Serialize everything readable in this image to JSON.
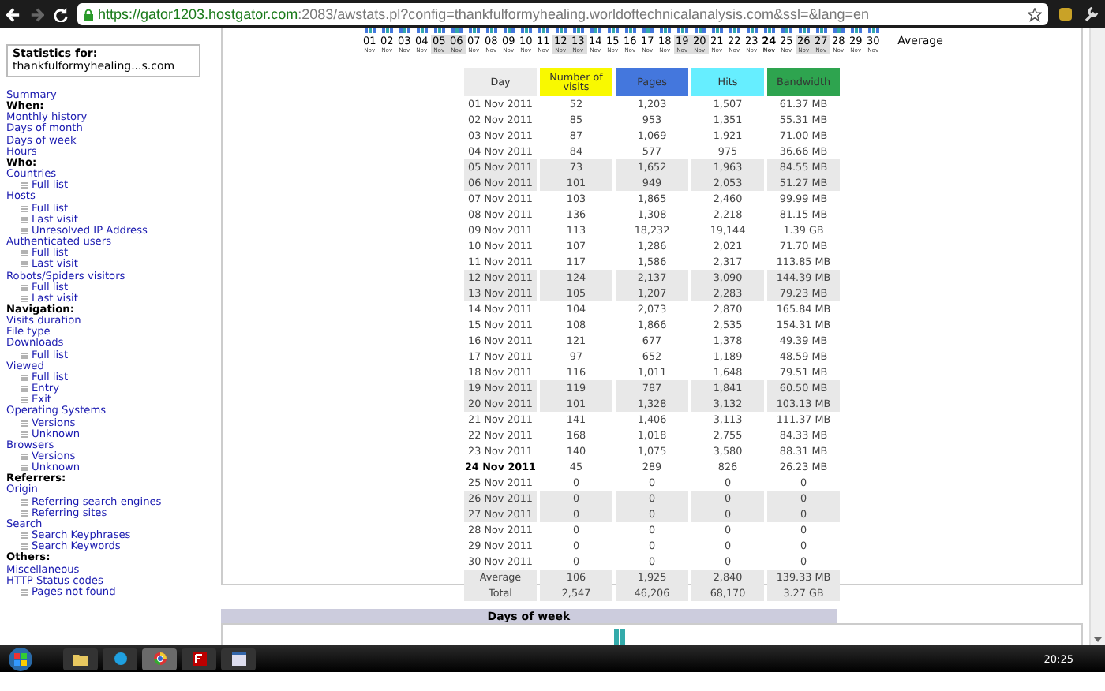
{
  "browser": {
    "url_host": "https://gator1203.hostgator.com",
    "url_rest": ":2083/awstats.pl?config=thankfulformyhealing.worldoftechnicalanalysis.com&ssl=&lang=en"
  },
  "sidebar": {
    "title": "Statistics for:",
    "site": "thankfulformyhealing...s.com",
    "nav": [
      {
        "kind": "link",
        "label": "Summary"
      },
      {
        "kind": "heading",
        "label": "When:"
      },
      {
        "kind": "link",
        "label": "Monthly history"
      },
      {
        "kind": "link",
        "label": "Days of month"
      },
      {
        "kind": "link",
        "label": "Days of week"
      },
      {
        "kind": "link",
        "label": "Hours"
      },
      {
        "kind": "heading",
        "label": "Who:"
      },
      {
        "kind": "link",
        "label": "Countries",
        "children": [
          {
            "label": "Full list"
          }
        ]
      },
      {
        "kind": "link",
        "label": "Hosts",
        "children": [
          {
            "label": "Full list"
          },
          {
            "label": "Last visit"
          },
          {
            "label": "Unresolved IP Address"
          }
        ]
      },
      {
        "kind": "link",
        "label": "Authenticated users",
        "children": [
          {
            "label": "Full list"
          },
          {
            "label": "Last visit"
          }
        ]
      },
      {
        "kind": "link",
        "label": "Robots/Spiders visitors",
        "children": [
          {
            "label": "Full list"
          },
          {
            "label": "Last visit"
          }
        ]
      },
      {
        "kind": "heading",
        "label": "Navigation:"
      },
      {
        "kind": "link",
        "label": "Visits duration"
      },
      {
        "kind": "link",
        "label": "File type"
      },
      {
        "kind": "link",
        "label": "Downloads",
        "children": [
          {
            "label": "Full list"
          }
        ]
      },
      {
        "kind": "link",
        "label": "Viewed",
        "children": [
          {
            "label": "Full list"
          },
          {
            "label": "Entry"
          },
          {
            "label": "Exit"
          }
        ]
      },
      {
        "kind": "link",
        "label": "Operating Systems",
        "children": [
          {
            "label": "Versions"
          },
          {
            "label": "Unknown"
          }
        ]
      },
      {
        "kind": "link",
        "label": "Browsers",
        "children": [
          {
            "label": "Versions"
          },
          {
            "label": "Unknown"
          }
        ]
      },
      {
        "kind": "heading",
        "label": "Referrers:"
      },
      {
        "kind": "link",
        "label": "Origin",
        "children": [
          {
            "label": "Referring search engines"
          },
          {
            "label": "Referring sites"
          }
        ]
      },
      {
        "kind": "link",
        "label": "Search",
        "children": [
          {
            "label": "Search Keyphrases"
          },
          {
            "label": "Search Keywords"
          }
        ]
      },
      {
        "kind": "heading",
        "label": "Others:"
      },
      {
        "kind": "link",
        "label": "Miscellaneous"
      },
      {
        "kind": "link",
        "label": "HTTP Status codes",
        "children": [
          {
            "label": "Pages not found"
          }
        ]
      }
    ]
  },
  "day_strip": {
    "days": [
      {
        "day": "01",
        "month": "Nov",
        "weekend": false,
        "today": false
      },
      {
        "day": "02",
        "month": "Nov",
        "weekend": false,
        "today": false
      },
      {
        "day": "03",
        "month": "Nov",
        "weekend": false,
        "today": false
      },
      {
        "day": "04",
        "month": "Nov",
        "weekend": false,
        "today": false
      },
      {
        "day": "05",
        "month": "Nov",
        "weekend": true,
        "today": false
      },
      {
        "day": "06",
        "month": "Nov",
        "weekend": true,
        "today": false
      },
      {
        "day": "07",
        "month": "Nov",
        "weekend": false,
        "today": false
      },
      {
        "day": "08",
        "month": "Nov",
        "weekend": false,
        "today": false
      },
      {
        "day": "09",
        "month": "Nov",
        "weekend": false,
        "today": false
      },
      {
        "day": "10",
        "month": "Nov",
        "weekend": false,
        "today": false
      },
      {
        "day": "11",
        "month": "Nov",
        "weekend": false,
        "today": false
      },
      {
        "day": "12",
        "month": "Nov",
        "weekend": true,
        "today": false
      },
      {
        "day": "13",
        "month": "Nov",
        "weekend": true,
        "today": false
      },
      {
        "day": "14",
        "month": "Nov",
        "weekend": false,
        "today": false
      },
      {
        "day": "15",
        "month": "Nov",
        "weekend": false,
        "today": false
      },
      {
        "day": "16",
        "month": "Nov",
        "weekend": false,
        "today": false
      },
      {
        "day": "17",
        "month": "Nov",
        "weekend": false,
        "today": false
      },
      {
        "day": "18",
        "month": "Nov",
        "weekend": false,
        "today": false
      },
      {
        "day": "19",
        "month": "Nov",
        "weekend": true,
        "today": false
      },
      {
        "day": "20",
        "month": "Nov",
        "weekend": true,
        "today": false
      },
      {
        "day": "21",
        "month": "Nov",
        "weekend": false,
        "today": false
      },
      {
        "day": "22",
        "month": "Nov",
        "weekend": false,
        "today": false
      },
      {
        "day": "23",
        "month": "Nov",
        "weekend": false,
        "today": false
      },
      {
        "day": "24",
        "month": "Nov",
        "weekend": false,
        "today": true
      },
      {
        "day": "25",
        "month": "Nov",
        "weekend": false,
        "today": false
      },
      {
        "day": "26",
        "month": "Nov",
        "weekend": true,
        "today": false
      },
      {
        "day": "27",
        "month": "Nov",
        "weekend": true,
        "today": false
      },
      {
        "day": "28",
        "month": "Nov",
        "weekend": false,
        "today": false
      },
      {
        "day": "29",
        "month": "Nov",
        "weekend": false,
        "today": false
      },
      {
        "day": "30",
        "month": "Nov",
        "weekend": false,
        "today": false
      }
    ],
    "average_label": "Average"
  },
  "table": {
    "columns": [
      {
        "label": "Day",
        "color": "#ececec"
      },
      {
        "label": "Number of visits",
        "color": "#f9f900"
      },
      {
        "label": "Pages",
        "color": "#4477dd"
      },
      {
        "label": "Hits",
        "color": "#66eeff"
      },
      {
        "label": "Bandwidth",
        "color": "#2ea44f"
      }
    ],
    "rows": [
      {
        "cells": [
          "01 Nov 2011",
          "52",
          "1,203",
          "1,507",
          "61.37 MB"
        ],
        "weekend": false,
        "today": false
      },
      {
        "cells": [
          "02 Nov 2011",
          "85",
          "953",
          "1,351",
          "55.31 MB"
        ],
        "weekend": false,
        "today": false
      },
      {
        "cells": [
          "03 Nov 2011",
          "87",
          "1,069",
          "1,921",
          "71.00 MB"
        ],
        "weekend": false,
        "today": false
      },
      {
        "cells": [
          "04 Nov 2011",
          "84",
          "577",
          "975",
          "36.66 MB"
        ],
        "weekend": false,
        "today": false
      },
      {
        "cells": [
          "05 Nov 2011",
          "73",
          "1,652",
          "1,963",
          "84.55 MB"
        ],
        "weekend": true,
        "today": false
      },
      {
        "cells": [
          "06 Nov 2011",
          "101",
          "949",
          "2,053",
          "51.27 MB"
        ],
        "weekend": true,
        "today": false
      },
      {
        "cells": [
          "07 Nov 2011",
          "103",
          "1,865",
          "2,460",
          "99.99 MB"
        ],
        "weekend": false,
        "today": false
      },
      {
        "cells": [
          "08 Nov 2011",
          "136",
          "1,308",
          "2,218",
          "81.15 MB"
        ],
        "weekend": false,
        "today": false
      },
      {
        "cells": [
          "09 Nov 2011",
          "113",
          "18,232",
          "19,144",
          "1.39 GB"
        ],
        "weekend": false,
        "today": false
      },
      {
        "cells": [
          "10 Nov 2011",
          "107",
          "1,286",
          "2,021",
          "71.70 MB"
        ],
        "weekend": false,
        "today": false
      },
      {
        "cells": [
          "11 Nov 2011",
          "117",
          "1,586",
          "2,317",
          "113.85 MB"
        ],
        "weekend": false,
        "today": false
      },
      {
        "cells": [
          "12 Nov 2011",
          "124",
          "2,137",
          "3,090",
          "144.39 MB"
        ],
        "weekend": true,
        "today": false
      },
      {
        "cells": [
          "13 Nov 2011",
          "105",
          "1,207",
          "2,283",
          "79.23 MB"
        ],
        "weekend": true,
        "today": false
      },
      {
        "cells": [
          "14 Nov 2011",
          "104",
          "2,073",
          "2,870",
          "165.84 MB"
        ],
        "weekend": false,
        "today": false
      },
      {
        "cells": [
          "15 Nov 2011",
          "108",
          "1,866",
          "2,535",
          "154.31 MB"
        ],
        "weekend": false,
        "today": false
      },
      {
        "cells": [
          "16 Nov 2011",
          "121",
          "677",
          "1,378",
          "49.39 MB"
        ],
        "weekend": false,
        "today": false
      },
      {
        "cells": [
          "17 Nov 2011",
          "97",
          "652",
          "1,189",
          "48.59 MB"
        ],
        "weekend": false,
        "today": false
      },
      {
        "cells": [
          "18 Nov 2011",
          "116",
          "1,011",
          "1,648",
          "79.51 MB"
        ],
        "weekend": false,
        "today": false
      },
      {
        "cells": [
          "19 Nov 2011",
          "119",
          "787",
          "1,841",
          "60.50 MB"
        ],
        "weekend": true,
        "today": false
      },
      {
        "cells": [
          "20 Nov 2011",
          "101",
          "1,328",
          "3,132",
          "103.13 MB"
        ],
        "weekend": true,
        "today": false
      },
      {
        "cells": [
          "21 Nov 2011",
          "141",
          "1,406",
          "3,113",
          "111.37 MB"
        ],
        "weekend": false,
        "today": false
      },
      {
        "cells": [
          "22 Nov 2011",
          "168",
          "1,018",
          "2,755",
          "84.33 MB"
        ],
        "weekend": false,
        "today": false
      },
      {
        "cells": [
          "23 Nov 2011",
          "140",
          "1,075",
          "3,580",
          "88.31 MB"
        ],
        "weekend": false,
        "today": false
      },
      {
        "cells": [
          "24 Nov 2011",
          "45",
          "289",
          "826",
          "26.23 MB"
        ],
        "weekend": false,
        "today": true
      },
      {
        "cells": [
          "25 Nov 2011",
          "0",
          "0",
          "0",
          "0"
        ],
        "weekend": false,
        "today": false
      },
      {
        "cells": [
          "26 Nov 2011",
          "0",
          "0",
          "0",
          "0"
        ],
        "weekend": true,
        "today": false
      },
      {
        "cells": [
          "27 Nov 2011",
          "0",
          "0",
          "0",
          "0"
        ],
        "weekend": true,
        "today": false
      },
      {
        "cells": [
          "28 Nov 2011",
          "0",
          "0",
          "0",
          "0"
        ],
        "weekend": false,
        "today": false
      },
      {
        "cells": [
          "29 Nov 2011",
          "0",
          "0",
          "0",
          "0"
        ],
        "weekend": false,
        "today": false
      },
      {
        "cells": [
          "30 Nov 2011",
          "0",
          "0",
          "0",
          "0"
        ],
        "weekend": false,
        "today": false
      }
    ],
    "summary_rows": [
      {
        "cells": [
          "Average",
          "106",
          "1,925",
          "2,840",
          "139.33 MB"
        ]
      },
      {
        "cells": [
          "Total",
          "2,547",
          "46,206",
          "68,170",
          "3.27 GB"
        ]
      }
    ]
  },
  "days_of_week": {
    "title": "Days of week"
  },
  "taskbar": {
    "clock": "20:25"
  }
}
